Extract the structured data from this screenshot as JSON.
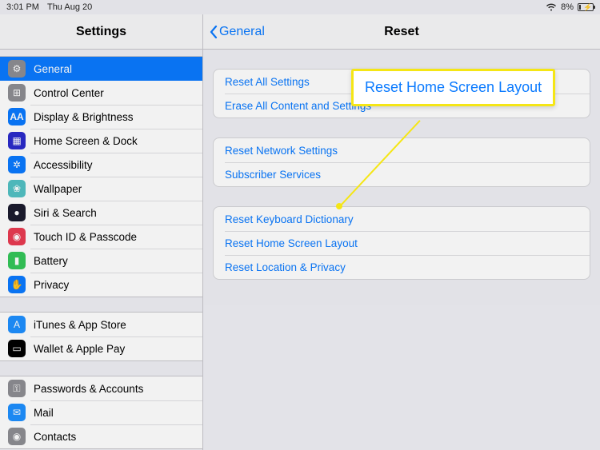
{
  "status": {
    "time": "3:01 PM",
    "date": "Thu Aug 20",
    "battery_pct": "8%"
  },
  "sidebar": {
    "title": "Settings",
    "groups": [
      [
        {
          "label": "General",
          "icon": "ic-general",
          "glyph": "⚙",
          "selected": true
        },
        {
          "label": "Control Center",
          "icon": "ic-control",
          "glyph": "⊞"
        },
        {
          "label": "Display & Brightness",
          "icon": "ic-display",
          "glyph": "AA"
        },
        {
          "label": "Home Screen & Dock",
          "icon": "ic-home",
          "glyph": "▦"
        },
        {
          "label": "Accessibility",
          "icon": "ic-access",
          "glyph": "✲"
        },
        {
          "label": "Wallpaper",
          "icon": "ic-wall",
          "glyph": "❀"
        },
        {
          "label": "Siri & Search",
          "icon": "ic-siri",
          "glyph": "●"
        },
        {
          "label": "Touch ID & Passcode",
          "icon": "ic-touch",
          "glyph": "◉"
        },
        {
          "label": "Battery",
          "icon": "ic-battery",
          "glyph": "▮"
        },
        {
          "label": "Privacy",
          "icon": "ic-privacy",
          "glyph": "✋"
        }
      ],
      [
        {
          "label": "iTunes & App Store",
          "icon": "ic-itunes",
          "glyph": "A"
        },
        {
          "label": "Wallet & Apple Pay",
          "icon": "ic-wallet",
          "glyph": "▭"
        }
      ],
      [
        {
          "label": "Passwords & Accounts",
          "icon": "ic-pwd",
          "glyph": "⚿"
        },
        {
          "label": "Mail",
          "icon": "ic-mail",
          "glyph": "✉"
        },
        {
          "label": "Contacts",
          "icon": "ic-contacts",
          "glyph": "◉"
        }
      ]
    ]
  },
  "detail": {
    "back": "General",
    "title": "Reset",
    "groups": [
      [
        "Reset All Settings",
        "Erase All Content and Settings"
      ],
      [
        "Reset Network Settings",
        "Subscriber Services"
      ],
      [
        "Reset Keyboard Dictionary",
        "Reset Home Screen Layout",
        "Reset Location & Privacy"
      ]
    ]
  },
  "callout": {
    "label": "Reset Home Screen Layout"
  }
}
